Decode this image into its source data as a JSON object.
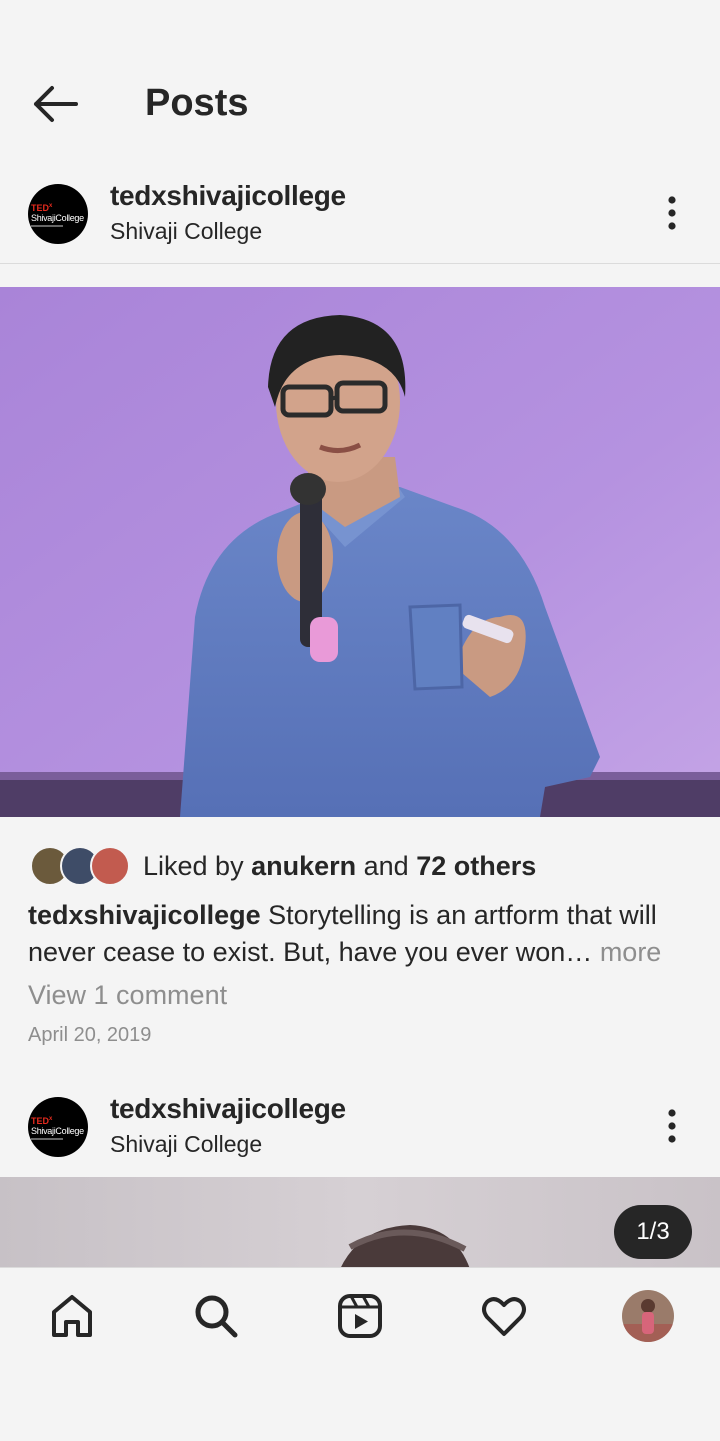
{
  "header": {
    "title": "Posts",
    "back_icon": "arrow-left-icon"
  },
  "posts": [
    {
      "username": "tedxshivajicollege",
      "location": "Shivaji College",
      "avatar_text": {
        "brand": "TED",
        "brand_sup": "x",
        "name": "ShivajiCollege"
      },
      "likes": {
        "prefix": "Liked by ",
        "user": "anukern",
        "connector": " and ",
        "others": "72 others"
      },
      "caption": {
        "username": "tedxshivajicollege",
        "text": " Storytelling is an artform that will never cease to exist. But, have you ever won… ",
        "more": "more"
      },
      "comments_link": "View 1 comment",
      "date": "April 20, 2019"
    },
    {
      "username": "tedxshivajicollege",
      "location": "Shivaji College",
      "avatar_text": {
        "brand": "TED",
        "brand_sup": "x",
        "name": "ShivajiCollege"
      },
      "carousel": "1/3"
    }
  ],
  "bottom_nav": {
    "items": [
      "home-icon",
      "search-icon",
      "reels-icon",
      "heart-icon",
      "profile-avatar"
    ]
  },
  "colors": {
    "text": "#262626",
    "muted": "#8e8e8e",
    "background": "#f4f4f4",
    "ted_red": "#e62b1e"
  }
}
